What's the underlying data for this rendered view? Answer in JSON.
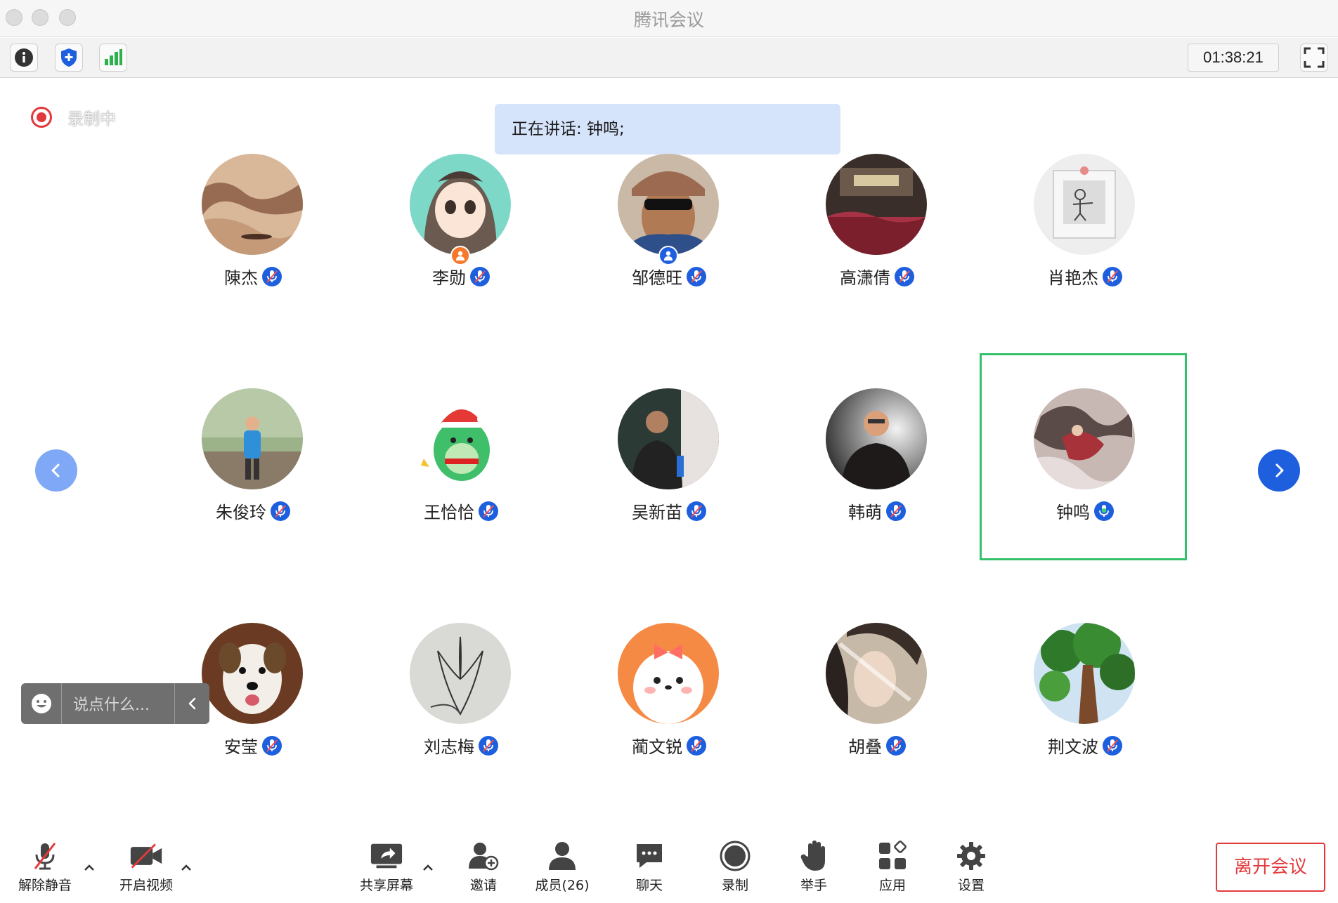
{
  "window": {
    "title": "腾讯会议"
  },
  "toolbar": {
    "info_icon": "info-icon",
    "security_icon": "shield-icon",
    "signal_icon": "signal-bars-icon",
    "timer": "01:38:21",
    "fullscreen_icon": "fullscreen-icon"
  },
  "recording": {
    "label": "录制中"
  },
  "speaking": {
    "text": "正在讲话: 钟鸣;"
  },
  "participants": [
    {
      "name": "陳杰",
      "mic": "muted"
    },
    {
      "name": "李勋",
      "mic": "muted",
      "role": "host"
    },
    {
      "name": "邹德旺",
      "mic": "muted",
      "role": "cohost"
    },
    {
      "name": "高潇倩",
      "mic": "muted"
    },
    {
      "name": "肖艳杰",
      "mic": "muted"
    },
    {
      "name": "朱俊玲",
      "mic": "muted"
    },
    {
      "name": "王恰恰",
      "mic": "muted"
    },
    {
      "name": "吴新苗",
      "mic": "muted"
    },
    {
      "name": "韩萌",
      "mic": "muted"
    },
    {
      "name": "钟鸣",
      "mic": "active",
      "speaking": true
    },
    {
      "name": "安莹",
      "mic": "muted"
    },
    {
      "name": "刘志梅",
      "mic": "muted"
    },
    {
      "name": "蔺文锐",
      "mic": "muted"
    },
    {
      "name": "胡叠",
      "mic": "muted"
    },
    {
      "name": "荆文波",
      "mic": "muted"
    }
  ],
  "chat": {
    "placeholder": "说点什么..."
  },
  "bottom": {
    "unmute": "解除静音",
    "video": "开启视频",
    "share": "共享屏幕",
    "invite": "邀请",
    "members": "成员(26)",
    "chat": "聊天",
    "record": "录制",
    "raise_hand": "举手",
    "apps": "应用",
    "settings": "设置",
    "leave": "离开会议"
  },
  "colors": {
    "accent": "#1e5fde",
    "speaking_frame": "#34c16b",
    "recording": "#e3393c",
    "banner": "#d6e4fb"
  }
}
